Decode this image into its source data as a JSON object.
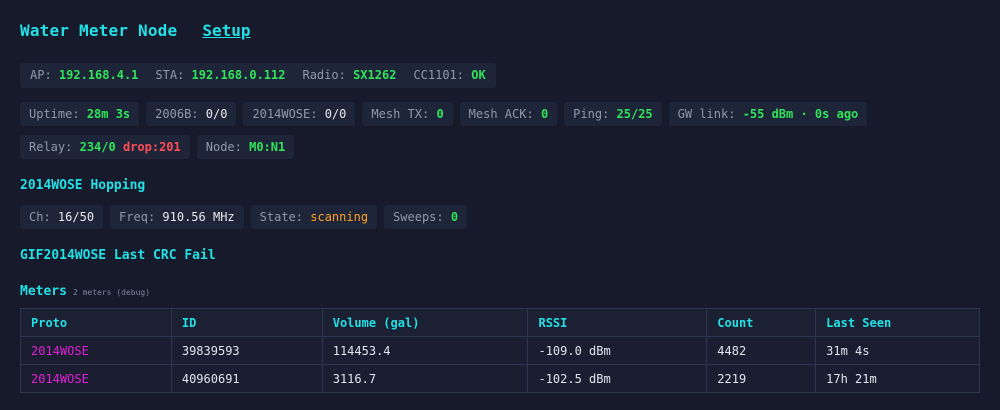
{
  "header": {
    "title": "Water Meter Node",
    "setup_label": "Setup"
  },
  "network": {
    "ap_label": "AP:",
    "ap_value": "192.168.4.1",
    "sta_label": "STA:",
    "sta_value": "192.168.0.112",
    "radio_label": "Radio:",
    "radio_value": "SX1262",
    "cc_label": "CC1101:",
    "cc_value": "OK"
  },
  "stats": [
    {
      "label": "Uptime:",
      "value": "28m 3s",
      "color": "#30e35a"
    },
    {
      "label": "2006B:",
      "value": "0/0",
      "color": "#e6e9f0"
    },
    {
      "label": "2014WOSE:",
      "value": "0/0",
      "color": "#e6e9f0"
    },
    {
      "label": "Mesh TX:",
      "value": "0",
      "color": "#30e35a"
    },
    {
      "label": "Mesh ACK:",
      "value": "0",
      "color": "#30e35a"
    },
    {
      "label": "Ping:",
      "value": "25/25",
      "color": "#30e35a"
    },
    {
      "label": "GW link:",
      "value": "-55 dBm · 0s ago",
      "color": "#30e35a"
    }
  ],
  "relay": {
    "label": "Relay:",
    "value": "234/0",
    "drop": "drop:201",
    "node_label": "Node:",
    "node_value": "M0:N1"
  },
  "hopping": {
    "title": "2014WOSE Hopping",
    "ch_label": "Ch:",
    "ch_value": "16/50",
    "freq_label": "Freq:",
    "freq_value": "910.56 MHz",
    "state_label": "State:",
    "state_value": "scanning",
    "sweeps_label": "Sweeps:",
    "sweeps_value": "0"
  },
  "crc": {
    "title": "GIF2014WOSE Last CRC Fail"
  },
  "meters": {
    "title": "Meters",
    "note": "2 meters (debug)",
    "columns": [
      "Proto",
      "ID",
      "Volume (gal)",
      "RSSI",
      "Count",
      "Last Seen"
    ],
    "rows": [
      [
        "2014WOSE",
        "39839593",
        "114453.4",
        "-109.0 dBm",
        "4482",
        "31m 4s"
      ],
      [
        "2014WOSE",
        "40960691",
        "3116.7",
        "-102.5 dBm",
        "2219",
        "17h 21m"
      ]
    ]
  }
}
